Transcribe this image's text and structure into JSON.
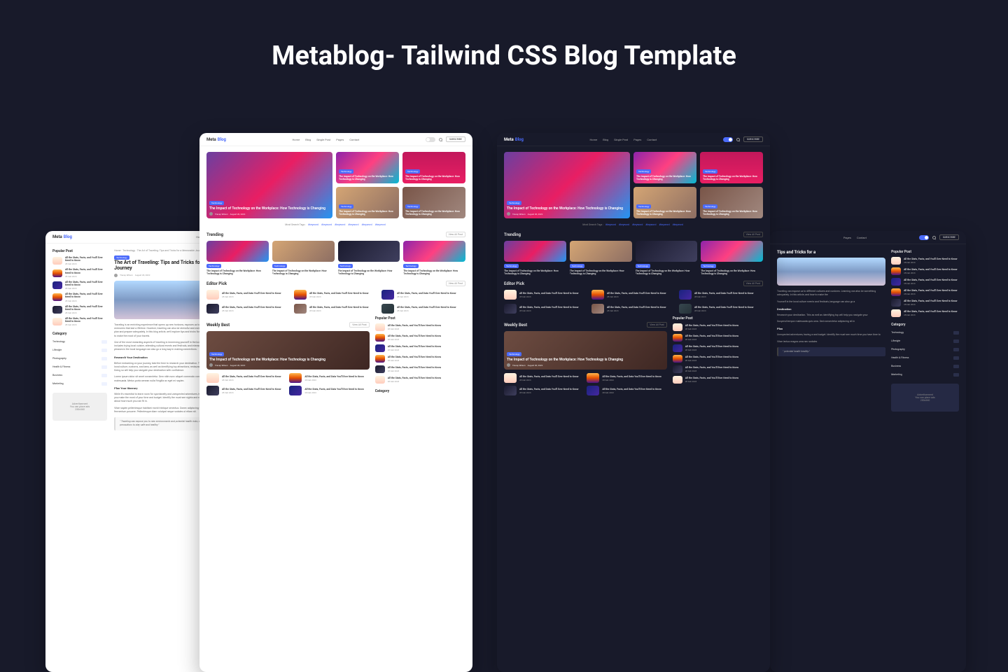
{
  "hero": "Metablog- Tailwind CSS Blog Template",
  "logo": {
    "a": "Meta",
    "b": "Blog"
  },
  "nav": [
    "Home",
    "Blog",
    "Single Post",
    "Pages",
    "Contact"
  ],
  "subscribe": "SUBSCRIBE",
  "badge": "Technology",
  "main_title": "The Impact of Technology on the Workplace: How Technology is Changing",
  "sm_title": "The Impact of Technology on the Workplace: How Technology is Changing",
  "author": "Tracey Wilson",
  "date": "August 20, 2022",
  "tags_label": "Most Search Tags :",
  "tags": [
    "#keyword",
    "#keyword",
    "#keyword",
    "#keyword",
    "#keyword",
    "#keyword"
  ],
  "sec": {
    "trending": "Trending",
    "editor": "Editor Pick",
    "weekly": "Weekly Best",
    "popular": "Popular Post",
    "category": "Category",
    "viewall": "View All Post"
  },
  "ep_title": "All the Stats, Facts, and Data You'll Ever Need to Know",
  "pp_title": "All the Stats, Facts, and You'll Ever Need to Know",
  "ep_date": "28 Feb 2023",
  "cats": [
    "Technology",
    "Lifestyle",
    "Photography",
    "Health & Fitness",
    "Business",
    "Marketing"
  ],
  "ad": {
    "l1": "Advertisement",
    "l2": "You can place ads",
    "l3": "250x360"
  },
  "article": {
    "bc": "Home · Technology · The Art of Traveling: Tips and Tricks for a Memorable Journey",
    "title_part": "The Art of Traveling: Tips and Tricks for a Memorable Journey",
    "p1": "Traveling is an enriching experience that opens up new horizons, exposes us to different cultures, and creates memories that last a lifetime. However, traveling can also be stressful and overwhelming, especially if you don't plan and prepare adequately. In this blog article, we'll explore tips and tricks for a memorable journey and how to make the most of your travels.",
    "p2": "One of the most rewarding aspects of traveling is immersing yourself in the local culture and customs. This includes trying local cuisine, attending cultural events and festivals, and interacting with locals. Learning a few phrases in the local language can also go a long way in making connections.",
    "h1": "Research Your Destination",
    "p3": "Before embarking on your journey, take the time to research your destination. This includes understanding the local culture, customs, and laws, as well as identifying top attractions, restaurants, and accommodations. Doing so will help you navigate your destination with confidence.",
    "p4": "Lorem ipsum dolor sit amet consectetur. Sem nibh nunc aliquet commodo convallis. Pretium at rhoncus malesuada. Metus porta aenean nulla fringilla ac eget mi sapien.",
    "h2": "Plan Your Itinerary",
    "p5": "While it's essential to leave room for spontaneity and unexpected adventures, having a rough itinerary can help you make the most of your time and budget. Identify the must-see sights and experiences, and be realistic about how much you can fit in.",
    "p6": "Vitae sapien pellentesque habitant morbi tristique senectus. Donec adipiscing tristique risus nec feugiat in fermentum posuere. Pellentesque diam volutpat neque sodales ut etiam sit.",
    "quote": "\" Traveling can expose you to new environments and potential health risks, so it's crucial to take precautions to stay safe and healthy.\""
  },
  "article_right": {
    "title": "Tips and Tricks for a",
    "p1": "Traveling can expose us to different cultures and customs. Learning can also be something adequately. In this article, and how to make the",
    "p2": "Yourself in the local culture events and festivals, language can also go a",
    "h1": "Destination",
    "p3": "Research your destination. This as well as identifying top will help you navigate your",
    "p4": "Suspend tempor malesuada quis urna. Sed consectetur adipiscing sit in",
    "h2": "Plan",
    "p5": "Unexpected adventures, having a and budget. Identify the must-see much time you have time to",
    "p6": "Vitae lectus magna urna nec sodales",
    "quote": "\" potential health healthy.\""
  }
}
